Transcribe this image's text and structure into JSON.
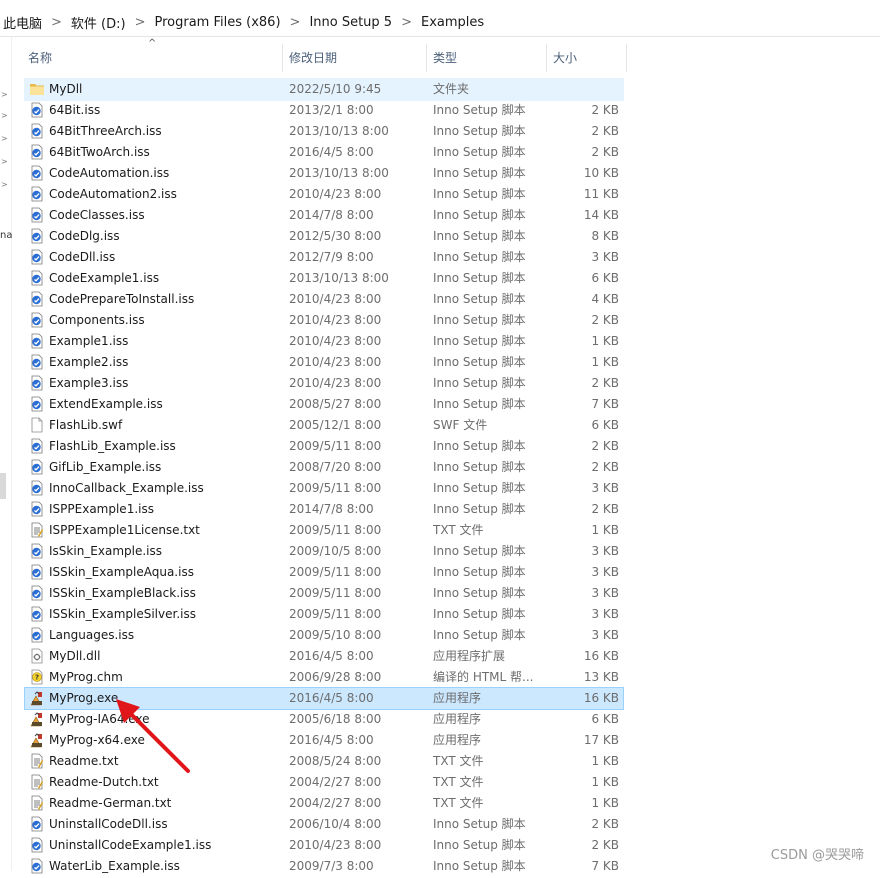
{
  "breadcrumb": [
    "此电脑",
    "软件 (D:)",
    "Program Files (x86)",
    "Inno Setup 5",
    "Examples"
  ],
  "columns": {
    "name": "名称",
    "date": "修改日期",
    "type": "类型",
    "size": "大小"
  },
  "files": [
    {
      "name": "MyDll",
      "date": "2022/5/10 9:45",
      "type": "文件夹",
      "size": "",
      "icon": "folder-icon"
    },
    {
      "name": "64Bit.iss",
      "date": "2013/2/1 8:00",
      "type": "Inno Setup 脚本",
      "size": "2 KB",
      "icon": "iss-file-icon"
    },
    {
      "name": "64BitThreeArch.iss",
      "date": "2013/10/13 8:00",
      "type": "Inno Setup 脚本",
      "size": "2 KB",
      "icon": "iss-file-icon"
    },
    {
      "name": "64BitTwoArch.iss",
      "date": "2016/4/5 8:00",
      "type": "Inno Setup 脚本",
      "size": "2 KB",
      "icon": "iss-file-icon"
    },
    {
      "name": "CodeAutomation.iss",
      "date": "2013/10/13 8:00",
      "type": "Inno Setup 脚本",
      "size": "10 KB",
      "icon": "iss-file-icon"
    },
    {
      "name": "CodeAutomation2.iss",
      "date": "2010/4/23 8:00",
      "type": "Inno Setup 脚本",
      "size": "11 KB",
      "icon": "iss-file-icon"
    },
    {
      "name": "CodeClasses.iss",
      "date": "2014/7/8 8:00",
      "type": "Inno Setup 脚本",
      "size": "14 KB",
      "icon": "iss-file-icon"
    },
    {
      "name": "CodeDlg.iss",
      "date": "2012/5/30 8:00",
      "type": "Inno Setup 脚本",
      "size": "8 KB",
      "icon": "iss-file-icon"
    },
    {
      "name": "CodeDll.iss",
      "date": "2012/7/9 8:00",
      "type": "Inno Setup 脚本",
      "size": "3 KB",
      "icon": "iss-file-icon"
    },
    {
      "name": "CodeExample1.iss",
      "date": "2013/10/13 8:00",
      "type": "Inno Setup 脚本",
      "size": "6 KB",
      "icon": "iss-file-icon"
    },
    {
      "name": "CodePrepareToInstall.iss",
      "date": "2010/4/23 8:00",
      "type": "Inno Setup 脚本",
      "size": "4 KB",
      "icon": "iss-file-icon"
    },
    {
      "name": "Components.iss",
      "date": "2010/4/23 8:00",
      "type": "Inno Setup 脚本",
      "size": "2 KB",
      "icon": "iss-file-icon"
    },
    {
      "name": "Example1.iss",
      "date": "2010/4/23 8:00",
      "type": "Inno Setup 脚本",
      "size": "1 KB",
      "icon": "iss-file-icon"
    },
    {
      "name": "Example2.iss",
      "date": "2010/4/23 8:00",
      "type": "Inno Setup 脚本",
      "size": "1 KB",
      "icon": "iss-file-icon"
    },
    {
      "name": "Example3.iss",
      "date": "2010/4/23 8:00",
      "type": "Inno Setup 脚本",
      "size": "2 KB",
      "icon": "iss-file-icon"
    },
    {
      "name": "ExtendExample.iss",
      "date": "2008/5/27 8:00",
      "type": "Inno Setup 脚本",
      "size": "7 KB",
      "icon": "iss-file-icon"
    },
    {
      "name": "FlashLib.swf",
      "date": "2005/12/1 8:00",
      "type": "SWF 文件",
      "size": "6 KB",
      "icon": "blank-file-icon"
    },
    {
      "name": "FlashLib_Example.iss",
      "date": "2009/5/11 8:00",
      "type": "Inno Setup 脚本",
      "size": "2 KB",
      "icon": "iss-file-icon"
    },
    {
      "name": "GifLib_Example.iss",
      "date": "2008/7/20 8:00",
      "type": "Inno Setup 脚本",
      "size": "2 KB",
      "icon": "iss-file-icon"
    },
    {
      "name": "InnoCallback_Example.iss",
      "date": "2009/5/11 8:00",
      "type": "Inno Setup 脚本",
      "size": "3 KB",
      "icon": "iss-file-icon"
    },
    {
      "name": "ISPPExample1.iss",
      "date": "2014/7/8 8:00",
      "type": "Inno Setup 脚本",
      "size": "2 KB",
      "icon": "iss-file-icon"
    },
    {
      "name": "ISPPExample1License.txt",
      "date": "2009/5/11 8:00",
      "type": "TXT 文件",
      "size": "1 KB",
      "icon": "txt-file-icon"
    },
    {
      "name": "IsSkin_Example.iss",
      "date": "2009/10/5 8:00",
      "type": "Inno Setup 脚本",
      "size": "3 KB",
      "icon": "iss-file-icon"
    },
    {
      "name": "ISSkin_ExampleAqua.iss",
      "date": "2009/5/11 8:00",
      "type": "Inno Setup 脚本",
      "size": "3 KB",
      "icon": "iss-file-icon"
    },
    {
      "name": "ISSkin_ExampleBlack.iss",
      "date": "2009/5/11 8:00",
      "type": "Inno Setup 脚本",
      "size": "3 KB",
      "icon": "iss-file-icon"
    },
    {
      "name": "ISSkin_ExampleSilver.iss",
      "date": "2009/5/11 8:00",
      "type": "Inno Setup 脚本",
      "size": "3 KB",
      "icon": "iss-file-icon"
    },
    {
      "name": "Languages.iss",
      "date": "2009/5/10 8:00",
      "type": "Inno Setup 脚本",
      "size": "3 KB",
      "icon": "iss-file-icon"
    },
    {
      "name": "MyDll.dll",
      "date": "2016/4/5 8:00",
      "type": "应用程序扩展",
      "size": "16 KB",
      "icon": "dll-file-icon"
    },
    {
      "name": "MyProg.chm",
      "date": "2006/9/28 8:00",
      "type": "编译的 HTML 帮...",
      "size": "13 KB",
      "icon": "chm-file-icon"
    },
    {
      "name": "MyProg.exe",
      "date": "2016/4/5 8:00",
      "type": "应用程序",
      "size": "16 KB",
      "icon": "exe-file-icon",
      "selected": true
    },
    {
      "name": "MyProg-IA64.exe",
      "date": "2005/6/18 8:00",
      "type": "应用程序",
      "size": "6 KB",
      "icon": "exe-file-icon"
    },
    {
      "name": "MyProg-x64.exe",
      "date": "2016/4/5 8:00",
      "type": "应用程序",
      "size": "17 KB",
      "icon": "exe-file-icon"
    },
    {
      "name": "Readme.txt",
      "date": "2008/5/24 8:00",
      "type": "TXT 文件",
      "size": "1 KB",
      "icon": "txt-file-icon"
    },
    {
      "name": "Readme-Dutch.txt",
      "date": "2004/2/27 8:00",
      "type": "TXT 文件",
      "size": "1 KB",
      "icon": "txt-file-icon"
    },
    {
      "name": "Readme-German.txt",
      "date": "2004/2/27 8:00",
      "type": "TXT 文件",
      "size": "1 KB",
      "icon": "txt-file-icon"
    },
    {
      "name": "UninstallCodeDll.iss",
      "date": "2006/10/4 8:00",
      "type": "Inno Setup 脚本",
      "size": "2 KB",
      "icon": "iss-file-icon"
    },
    {
      "name": "UninstallCodeExample1.iss",
      "date": "2010/4/23 8:00",
      "type": "Inno Setup 脚本",
      "size": "2 KB",
      "icon": "iss-file-icon"
    },
    {
      "name": "WaterLib_Example.iss",
      "date": "2009/7/3 8:00",
      "type": "Inno Setup 脚本",
      "size": "7 KB",
      "icon": "iss-file-icon"
    }
  ],
  "nav_fragment": "na",
  "watermark": "CSDN @哭哭啼",
  "colors": {
    "selection_bg": "#cce8ff",
    "selection_border": "#99d1ff",
    "hover_bg": "#e5f3ff",
    "header_text": "#4c607a",
    "annotation_arrow": "#e0161b"
  }
}
